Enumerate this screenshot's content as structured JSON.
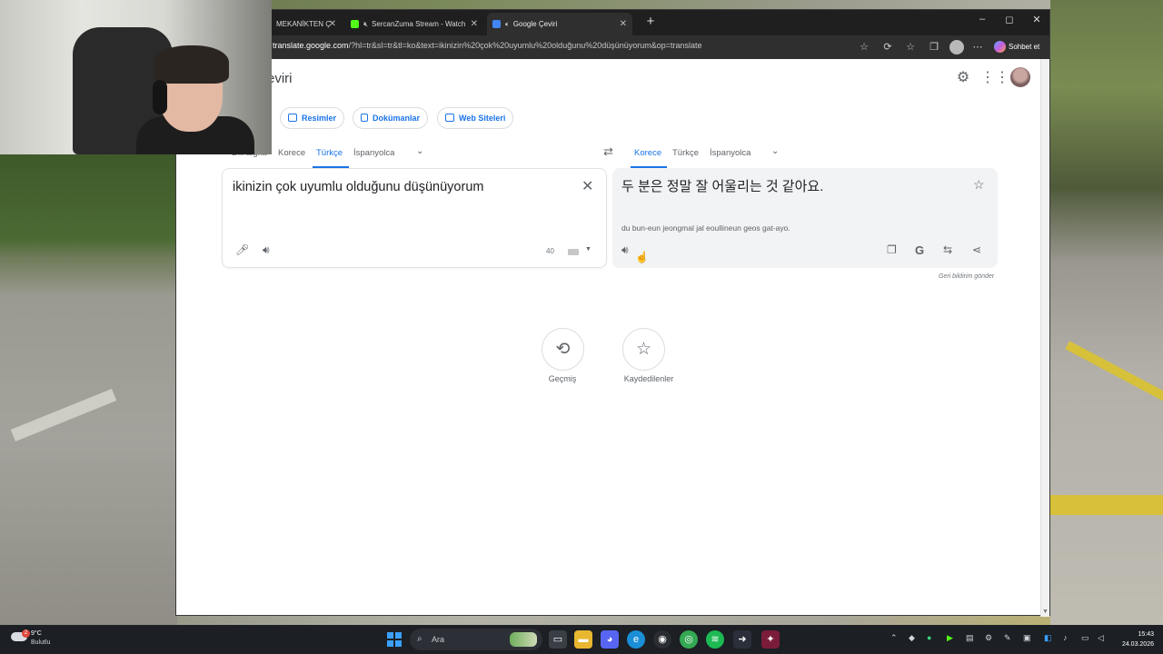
{
  "browser": {
    "tabs": [
      {
        "title": "MEKANİKTEN Ç",
        "color": "#2f2f2f"
      },
      {
        "title": "SercanZuma Stream - Watch",
        "color": "#53fc18"
      },
      {
        "title": "Google Çeviri",
        "color": "#4285f4"
      }
    ],
    "new_tab": "+",
    "controls": {
      "minimize": "–",
      "maximize": "◻",
      "close": "✕"
    },
    "url_host": "translate.google.com",
    "url_rest": "/?hl=tr&sl=tr&tl=ko&text=ikinizin%20çok%20uyumlu%20olduğunu%20düşünüyorum&op=translate",
    "copilot_label": "Sohbet et"
  },
  "translate": {
    "title": "eviri",
    "modes": [
      {
        "label": "Resimler"
      },
      {
        "label": "Dokümanlar"
      },
      {
        "label": "Web Siteleri"
      }
    ],
    "source_langs": [
      "Dili algıla",
      "Korece",
      "Türkçe",
      "İspanyolca"
    ],
    "target_langs": [
      "Korece",
      "Türkçe",
      "İspanyolca"
    ],
    "source_text": "ikinizin çok uyumlu olduğunu düşünüyorum",
    "char_count": "40",
    "target_text": "두 분은 정말 잘 어울리는 것 같아요.",
    "transliteration": "du bun-eun jeongmal jal eoullineun geos gat-ayo.",
    "feedback": "Geri bildirim gönder",
    "history_label": "Geçmiş",
    "saved_label": "Kaydedilenler"
  },
  "taskbar": {
    "weather_temp": "9°C",
    "weather_cond": "Bulutlu",
    "weather_badge": "2",
    "search_placeholder": "Ara",
    "time": "15:43",
    "date": "24.03.2026"
  },
  "colors": {
    "accent": "#1a73e8",
    "taskbar": "#1c1f24",
    "tabbar": "#1f1f1f"
  }
}
